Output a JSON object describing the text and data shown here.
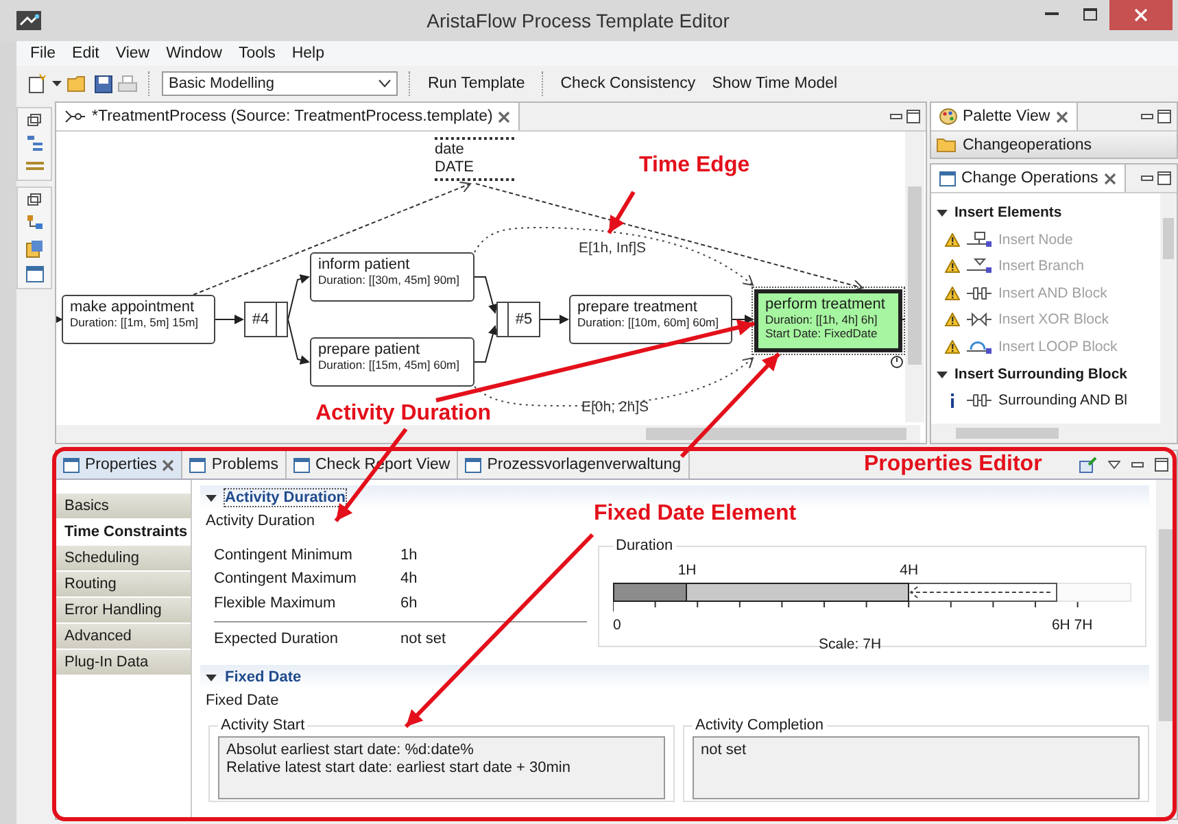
{
  "window": {
    "title": "AristaFlow Process Template Editor"
  },
  "menu": [
    "File",
    "Edit",
    "View",
    "Window",
    "Tools",
    "Help"
  ],
  "toolbar": {
    "perspective": "Basic Modelling",
    "buttons": [
      "Run Template",
      "Check Consistency",
      "Show Time Model"
    ]
  },
  "editor": {
    "tab": "*TreatmentProcess (Source: TreatmentProcess.template)",
    "nodes": [
      {
        "kind": "data",
        "name": "date",
        "type": "DATE"
      },
      {
        "kind": "activity",
        "name": "make appointment",
        "details": [
          "Duration: [[1m, 5m] 15m]"
        ],
        "selected": false
      },
      {
        "kind": "gateway",
        "name": "#4"
      },
      {
        "kind": "activity",
        "name": "inform patient",
        "details": [
          "Duration: [[30m, 45m] 90m]"
        ],
        "selected": false
      },
      {
        "kind": "activity",
        "name": "prepare patient",
        "details": [
          "Duration: [[15m, 45m] 60m]"
        ],
        "selected": false
      },
      {
        "kind": "gateway",
        "name": "#5"
      },
      {
        "kind": "activity",
        "name": "prepare treatment",
        "details": [
          "Duration: [[10m, 60m] 60m]"
        ],
        "selected": false
      },
      {
        "kind": "activity",
        "name": "perform treatment",
        "details": [
          "Duration: [[1h, 4h] 6h]",
          "Start Date: FixedDate"
        ],
        "selected": true
      }
    ],
    "edge_labels": [
      "E[1h, Inf]S",
      "E[0h, 2h]S"
    ]
  },
  "palette": {
    "tab": "Palette View",
    "folder": "Changeoperations",
    "view_tab": "Change Operations",
    "groups": [
      {
        "title": "Insert Elements",
        "expanded": true,
        "items": [
          {
            "kind": "node",
            "label": "Insert Node",
            "warning": true,
            "disabled": true
          },
          {
            "kind": "branch",
            "label": "Insert Branch",
            "warning": true,
            "disabled": true
          },
          {
            "kind": "and",
            "label": "Insert AND Block",
            "warning": true,
            "disabled": true
          },
          {
            "kind": "xor",
            "label": "Insert XOR Block",
            "warning": true,
            "disabled": true
          },
          {
            "kind": "loop",
            "label": "Insert LOOP Block",
            "warning": true,
            "disabled": true
          }
        ]
      },
      {
        "title": "Insert Surrounding Block",
        "expanded": true,
        "items": [
          {
            "kind": "and",
            "label": "Surrounding AND Bl",
            "warning": false,
            "disabled": false
          }
        ]
      }
    ]
  },
  "properties": {
    "tabs": [
      {
        "label": "Properties",
        "selected": true
      },
      {
        "label": "Problems",
        "selected": false
      },
      {
        "label": "Check Report View",
        "selected": false
      },
      {
        "label": "Prozessvorlagenverwaltung",
        "selected": false
      }
    ],
    "nav": [
      {
        "label": "Basics",
        "selected": false
      },
      {
        "label": "Time Constraints",
        "selected": true
      },
      {
        "label": "Scheduling",
        "selected": false
      },
      {
        "label": "Routing",
        "selected": false
      },
      {
        "label": "Error Handling",
        "selected": false
      },
      {
        "label": "Advanced",
        "selected": false
      },
      {
        "label": "Plug-In Data",
        "selected": false
      }
    ],
    "activity_duration": {
      "header": "Activity Duration",
      "expanded": true,
      "subtitle": "Activity Duration",
      "rows": [
        {
          "label": "Contingent Minimum",
          "value": "1h"
        },
        {
          "label": "Contingent Maximum",
          "value": "4h"
        },
        {
          "label": "Flexible Maximum",
          "value": "6h"
        }
      ],
      "expected": {
        "label": "Expected Duration",
        "value": "not set"
      },
      "duration": {
        "title": "Duration",
        "segments": [
          {
            "kind": "fixed",
            "level": 0.143,
            "label": "1H"
          },
          {
            "kind": "contingent",
            "level": 0.571,
            "label": "4H"
          },
          {
            "kind": "flexible",
            "level": 0.857
          }
        ],
        "axis_labels": [
          "0",
          "6H 7H"
        ],
        "scale": "Scale: 7H"
      }
    },
    "fixed_date": {
      "header": "Fixed Date",
      "expanded": true,
      "subtitle": "Fixed Date",
      "groups": [
        {
          "title": "Activity Start",
          "lines": [
            "Absolut earliest start date: %d:date%",
            "Relative latest start date: earliest start date + 30min"
          ]
        },
        {
          "title": "Activity Completion",
          "lines": [
            "not set"
          ]
        }
      ]
    }
  },
  "annotations": [
    "Time Edge",
    "Activity Duration",
    "Fixed Date Element",
    "Properties Editor"
  ]
}
